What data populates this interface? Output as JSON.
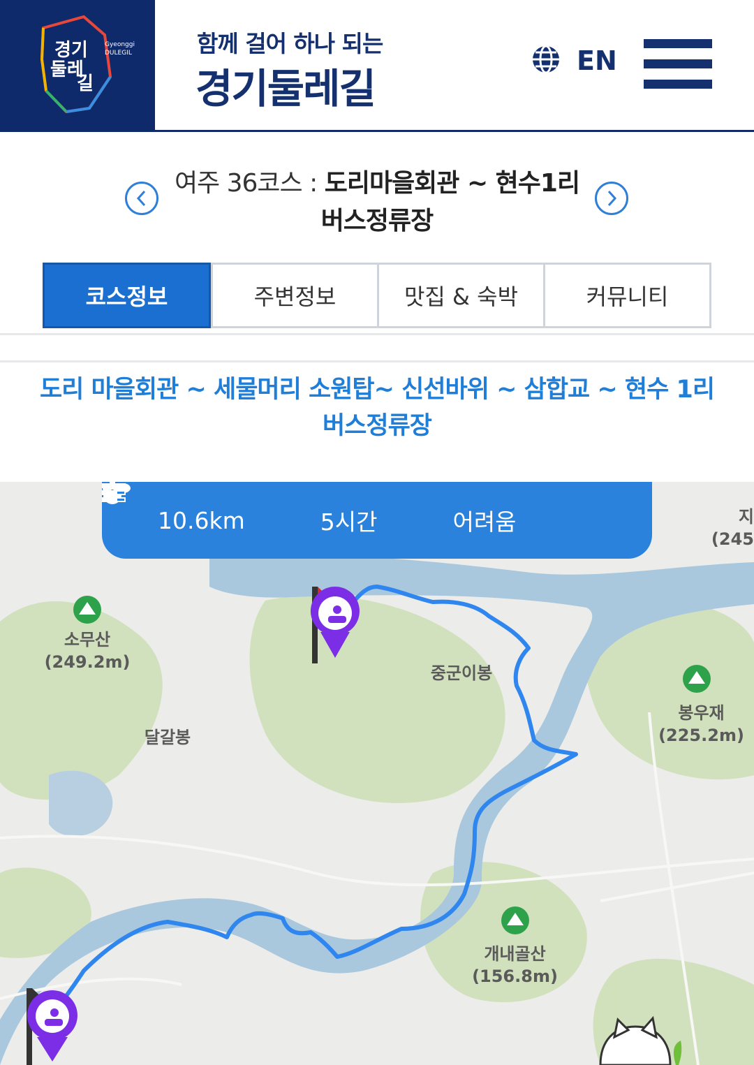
{
  "header": {
    "logo": {
      "text_lines": [
        "경기",
        "둘레",
        "길"
      ],
      "en_line1": "Gyeonggi",
      "en_line2": "DULEGIL"
    },
    "subtitle": "함께 걸어 하나 되는",
    "title": "경기둘레길",
    "language_label": "EN",
    "icons": {
      "language": "globe-icon",
      "menu": "hamburger-menu-icon"
    }
  },
  "course": {
    "prefix": "여주 36코스 :",
    "name": "도리마을회관 ~ 현수1리 버스정류장"
  },
  "tabs": [
    {
      "label": "코스정보",
      "active": true
    },
    {
      "label": "주변정보",
      "active": false
    },
    {
      "label": "맛집 & 숙박",
      "active": false
    },
    {
      "label": "커뮤니티",
      "active": false
    }
  ],
  "route_summary": "도리 마을회관 ~ 세물머리 소원탑~ 신선바위 ~ 삼합교 ~ 현수 1리 버스정류장",
  "stats": {
    "distance": "10.6km",
    "time": "5시간",
    "difficulty": "어려움"
  },
  "map": {
    "labels": {
      "somusan": "소무산",
      "somusan_elev": "(249.2m)",
      "dalgalbong": "달갈봉",
      "jungguni": "중군이봉",
      "bonguje": "봉우재",
      "bonguje_elev": "(225.2m)",
      "gaenaegolsan": "개내골산",
      "gaenaegolsan_elev": "(156.8m)",
      "ji_partial": "지",
      "ji_elev_partial": "(245"
    },
    "colors": {
      "route": "#2f86ee",
      "river": "#a9c7dd",
      "forest": "#c9ddb0",
      "marker": "#7b2ee6"
    }
  },
  "colors": {
    "navy": "#14306e",
    "accent": "#1b6fd0",
    "link_blue": "#1f7ed8"
  }
}
